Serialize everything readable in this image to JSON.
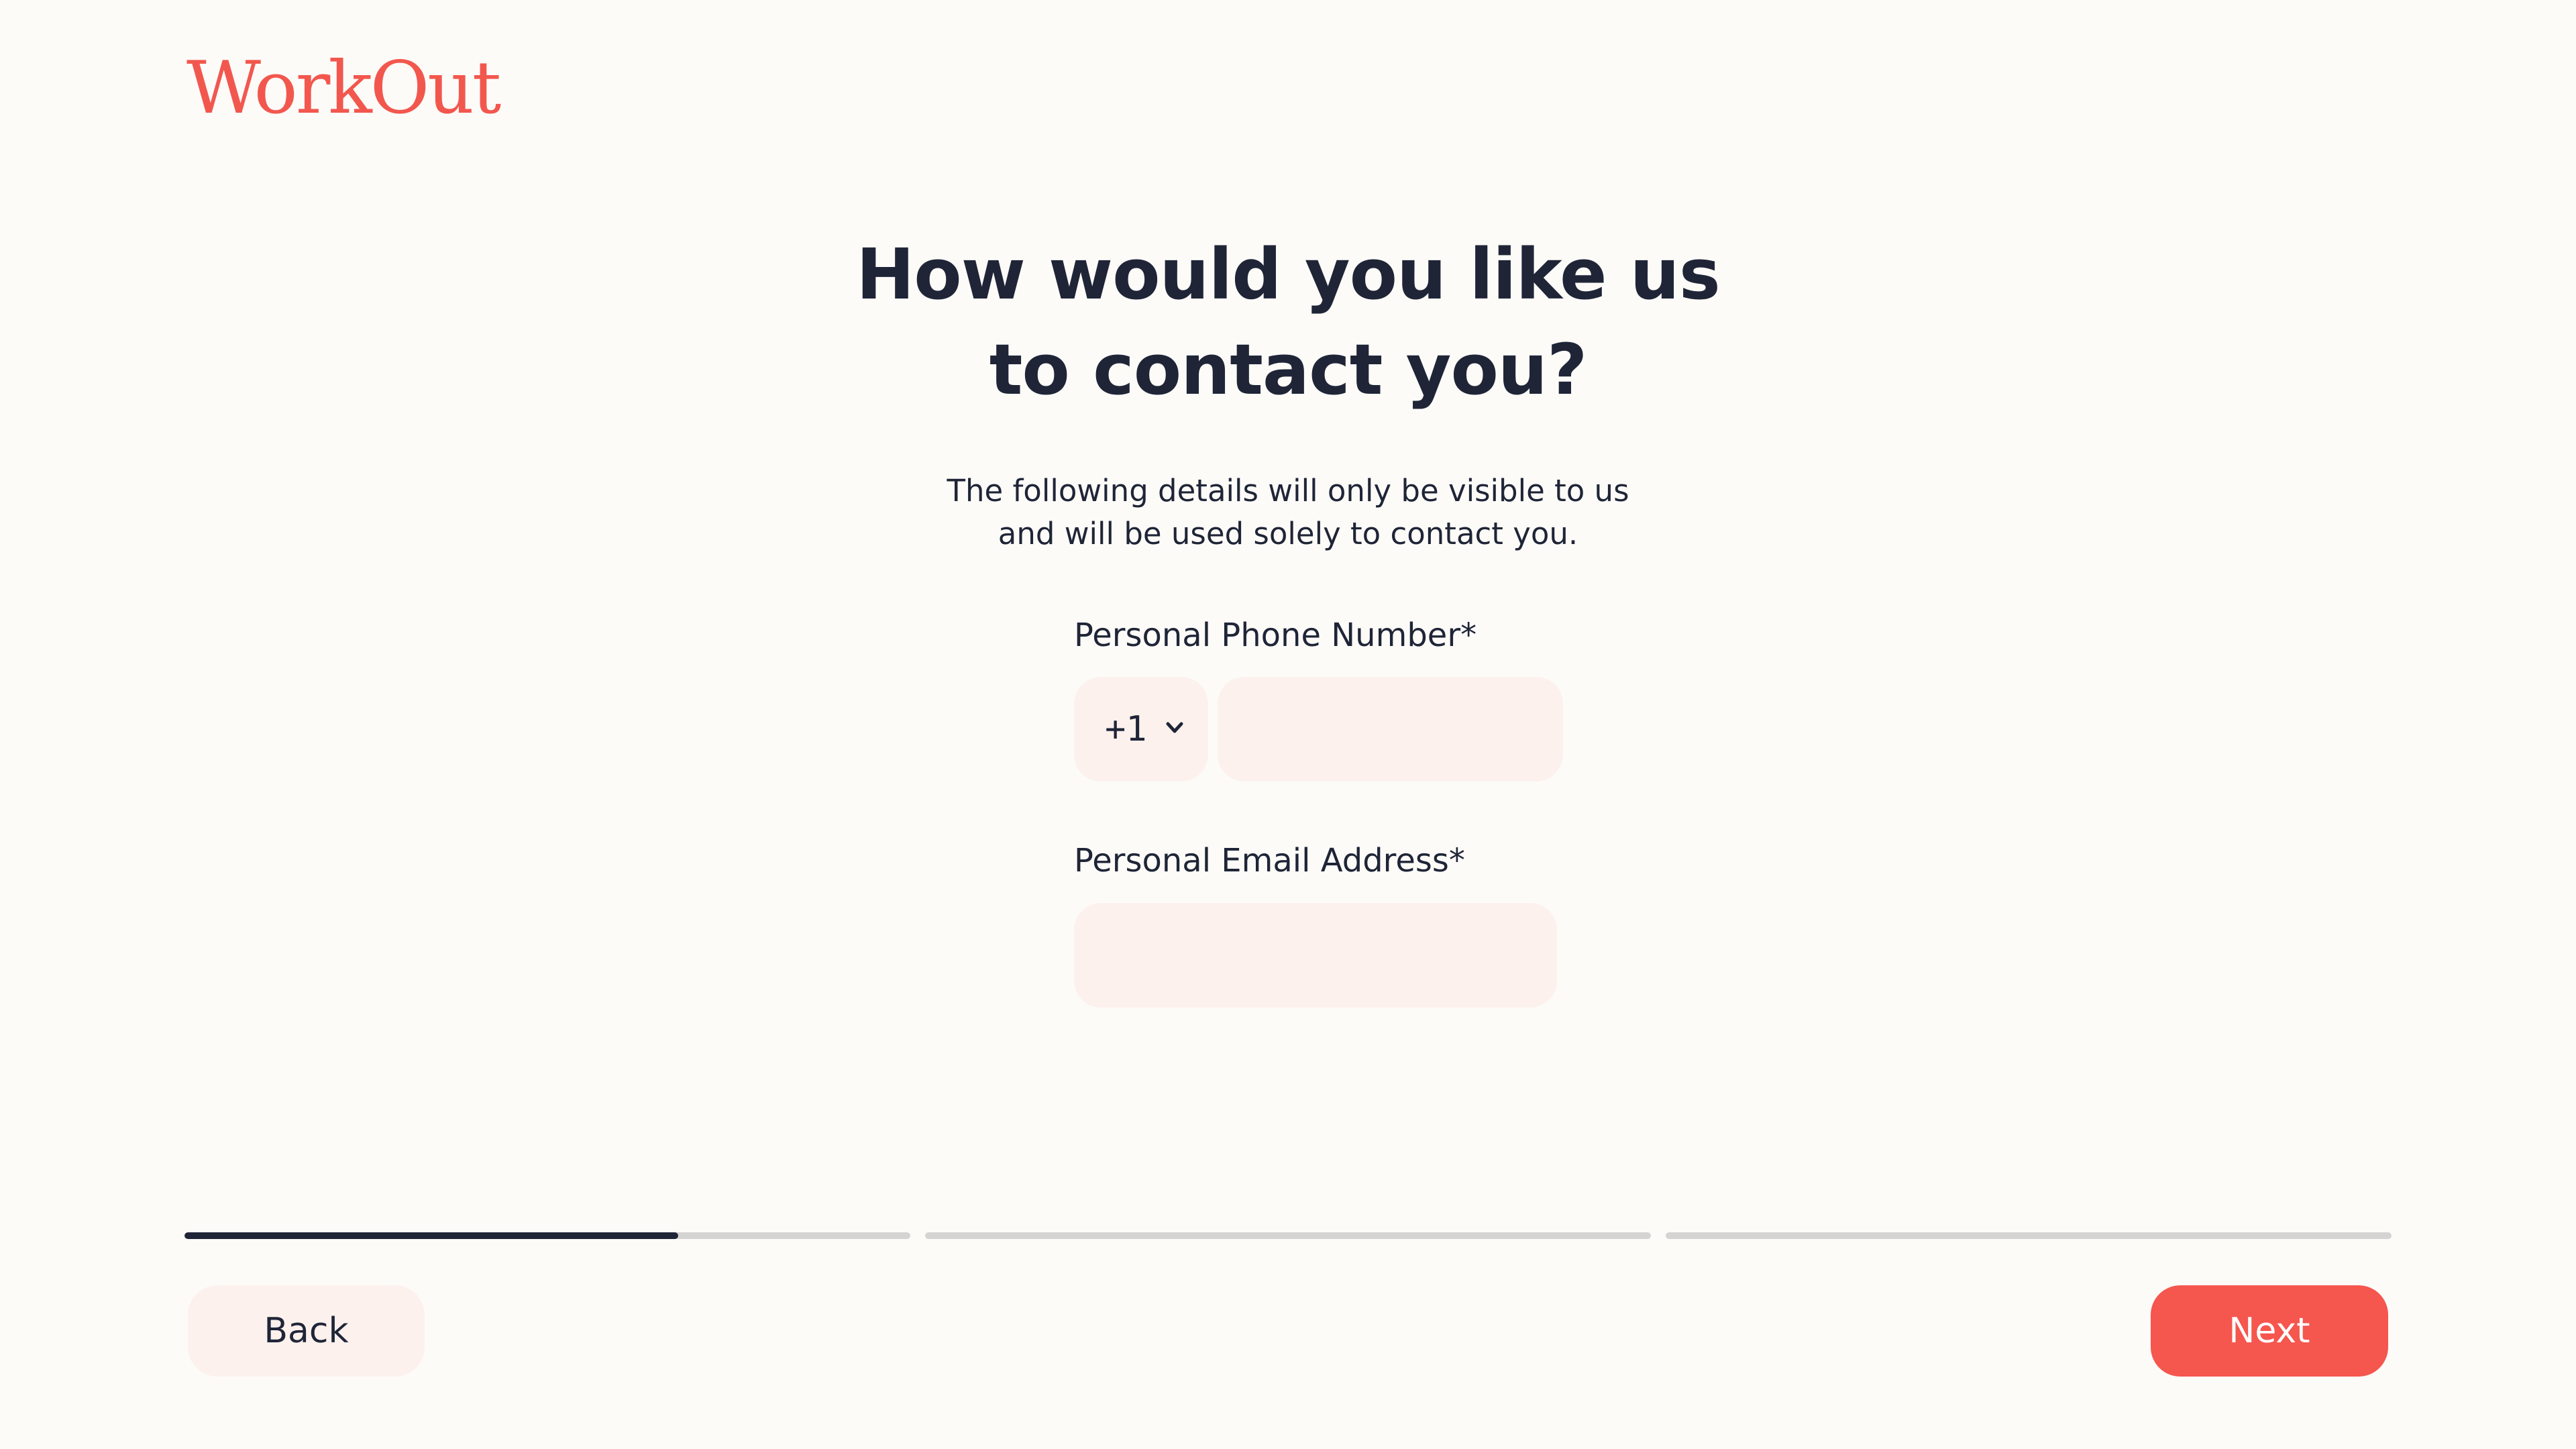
{
  "brand": {
    "logo_text": "WorkOut",
    "accent_color": "#f2574e"
  },
  "heading": {
    "line1": "How would you like us",
    "line2": "to contact you?"
  },
  "subtext": {
    "line1": "The following details will only be visible to us",
    "line2": "and will be used solely to contact you."
  },
  "form": {
    "phone": {
      "label": "Personal Phone Number*",
      "country_code": "+1",
      "country_icon": "chevron-down-icon",
      "value": ""
    },
    "email": {
      "label": "Personal Email Address*",
      "value": ""
    }
  },
  "progress": {
    "steps": [
      {
        "fraction": 0.68
      },
      {
        "fraction": 0
      },
      {
        "fraction": 0
      }
    ]
  },
  "nav": {
    "back_label": "Back",
    "next_label": "Next"
  }
}
